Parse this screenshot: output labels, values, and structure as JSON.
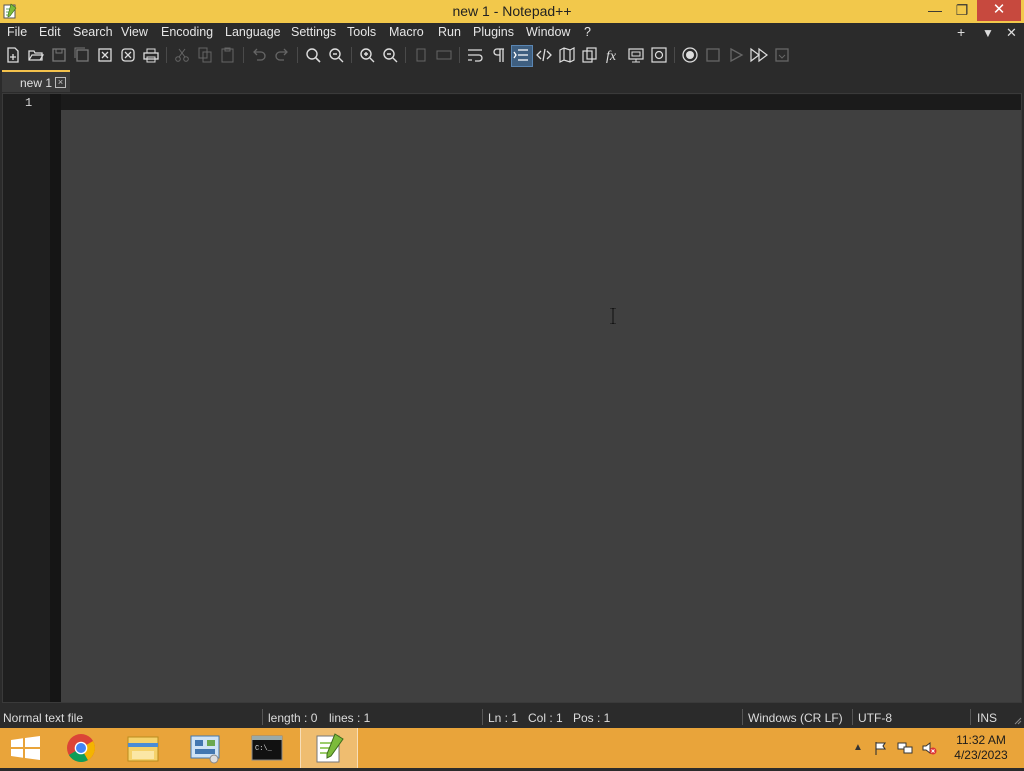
{
  "window": {
    "title": "new 1 - Notepad++",
    "min_glyph": "—",
    "max_glyph": "❐",
    "close_glyph": "✕"
  },
  "menu": {
    "items": [
      "File",
      "Edit",
      "Search",
      "View",
      "Encoding",
      "Language",
      "Settings",
      "Tools",
      "Macro",
      "Run",
      "Plugins",
      "Window",
      "?"
    ],
    "add_glyph": "+",
    "dropdown_glyph": "▼",
    "close_glyph": "✕"
  },
  "toolbar": {
    "icons": [
      "new-file-icon",
      "open-file-icon",
      "save-icon",
      "save-all-icon",
      "close-icon",
      "close-all-icon",
      "print-icon",
      "cut-icon",
      "copy-icon",
      "paste-icon",
      "undo-icon",
      "redo-icon",
      "find-icon",
      "replace-icon",
      "zoom-in-icon",
      "zoom-out-icon",
      "sync-vertical-icon",
      "sync-horizontal-icon",
      "word-wrap-icon",
      "show-all-characters-icon",
      "indent-guide-icon",
      "code-tag-icon",
      "document-map-icon",
      "clone-icon",
      "function-list-icon",
      "folder-as-workspace-icon",
      "monitoring-icon",
      "record-macro-icon",
      "stop-macro-icon",
      "play-macro-icon",
      "run-macro-multiple-icon",
      "save-macro-icon"
    ],
    "active_icon": "indent-guide-icon"
  },
  "tabs": [
    {
      "label": "new 1",
      "close_glyph": "×"
    }
  ],
  "editor": {
    "line_numbers": [
      "1"
    ],
    "content": ""
  },
  "status": {
    "file_type": "Normal text file",
    "length": "length : 0",
    "lines": "lines : 1",
    "ln": "Ln : 1",
    "col": "Col : 1",
    "pos": "Pos : 1",
    "eol": "Windows (CR LF)",
    "encoding": "UTF-8",
    "mode": "INS"
  },
  "taskbar": {
    "apps": [
      "start-icon",
      "chrome-icon",
      "file-explorer-icon",
      "control-panel-icon",
      "command-prompt-icon",
      "notepad-plus-plus-icon"
    ],
    "active_app": "notepad-plus-plus-icon",
    "cmd_label": "C:\\_",
    "tray": [
      "show-hidden-icons-icon",
      "action-center-flag-icon",
      "network-icon",
      "volume-muted-icon"
    ],
    "tray_arrow_glyph": "▲",
    "time": "11:32 AM",
    "date": "4/23/2023"
  },
  "colors": {
    "title_bar": "#f2c84b",
    "taskbar": "#e9a43a",
    "editor_bg": "#404040",
    "close_button": "#c7493e"
  }
}
